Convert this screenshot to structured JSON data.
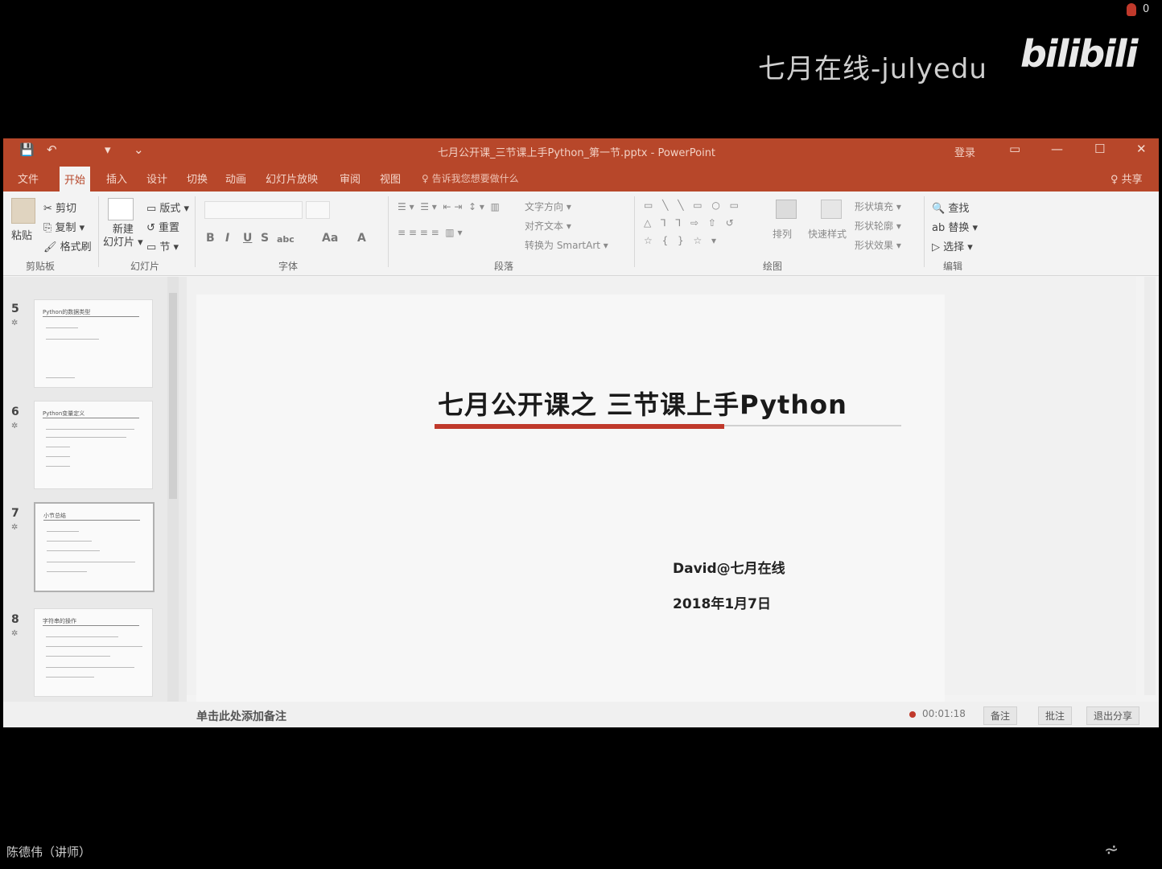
{
  "overlay": {
    "watermark": "七月在线-julyedu",
    "logo": "bilibili",
    "corner_count": "0"
  },
  "titlebar": {
    "title": "七月公开课_三节课上手Python_第一节.pptx - PowerPoint",
    "login": "登录",
    "quick_access": {
      "save": "💾",
      "undo": "↶",
      "redo": "▾",
      "customize": "⌄"
    },
    "controls": {
      "ribbon_display": "▭",
      "minimize": "—",
      "maximize": "☐",
      "close": "✕"
    }
  },
  "tabs": [
    "文件",
    "开始",
    "插入",
    "设计",
    "切换",
    "动画",
    "幻灯片放映",
    "审阅",
    "视图"
  ],
  "active_tab": "开始",
  "tellme": "♀ 告诉我您想要做什么",
  "share": "♀ 共享",
  "ribbon": {
    "clipboard": {
      "paste": "粘贴",
      "cut": "✂ 剪切",
      "copy": "⎘ 复制 ▾",
      "format_painter": "🖌 格式刷",
      "label": "剪贴板"
    },
    "slides": {
      "new_slide": "新建\n幻灯片 ▾",
      "layout": "▭ 版式 ▾",
      "reset": "↺ 重置",
      "section": "▭ 节 ▾",
      "label": "幻灯片"
    },
    "font": {
      "label": "字体",
      "bold": "B",
      "italic": "I",
      "underline": "U",
      "strike": "S",
      "spacing": "abc",
      "case": "Aa",
      "color": "A"
    },
    "paragraph": {
      "label": "段落",
      "text_direction": "文字方向 ▾",
      "align_text": "对齐文本 ▾",
      "smartart": "转换为 SmartArt ▾"
    },
    "drawing": {
      "label": "绘图",
      "arrange": "排列",
      "quick_styles": "快速样式",
      "shape_fill": "形状填充 ▾",
      "shape_outline": "形状轮廓 ▾",
      "shape_effects": "形状效果 ▾"
    },
    "editing": {
      "label": "编辑",
      "find": "🔍 查找",
      "replace": "ab 替换 ▾",
      "select": "▷ 选择 ▾"
    }
  },
  "thumbnails": [
    {
      "num": "5",
      "title": "Python的数据类型"
    },
    {
      "num": "6",
      "title": "Python变量定义"
    },
    {
      "num": "7",
      "title": "小节总结"
    },
    {
      "num": "8",
      "title": "字符串的操作"
    }
  ],
  "slide": {
    "title": "七月公开课之 三节课上手Python",
    "author": "David@七月在线",
    "date": "2018年1月7日"
  },
  "statusbar": {
    "notes_hint": "单击此处添加备注",
    "rec_time": "00:01:18",
    "btn_notes": "备注",
    "btn_comments": "批注",
    "btn_exit": "退出分享"
  },
  "footer": {
    "presenter": "陈德伟（讲师）",
    "icon": "⩫"
  }
}
